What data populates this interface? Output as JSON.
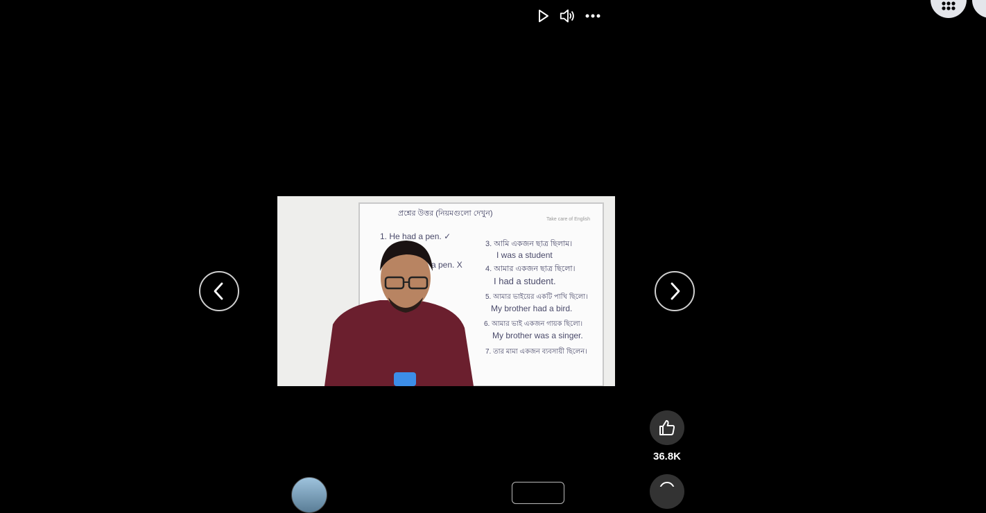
{
  "controls": {
    "play_icon": "play-icon",
    "volume_icon": "volume-icon",
    "more_icon": "more-icon"
  },
  "video": {
    "whiteboard": {
      "header": "প্রশ্নের উত্তর (নিয়মগুলো দেখুন)",
      "watermark": "Take care of English",
      "lines_left": [
        "1. He had a pen. ✓",
        "a pen. X"
      ],
      "lines_right": [
        "3. আমি একজন ছাত্র ছিলাম।",
        "I was a student",
        "4. আমার একজন ছাত্র ছিলো।",
        "I had a student.",
        "5. আমার ভাইয়ের একটি পাখি ছিলো।",
        "My brother had a bird.",
        "6. আমার ভাই একজন গায়ক ছিলো।",
        "My brother was a singer.",
        "7. তার মামা একজন ব্যবসায়ী ছিলেন।"
      ]
    }
  },
  "actions": {
    "like_count": "36.8K"
  }
}
